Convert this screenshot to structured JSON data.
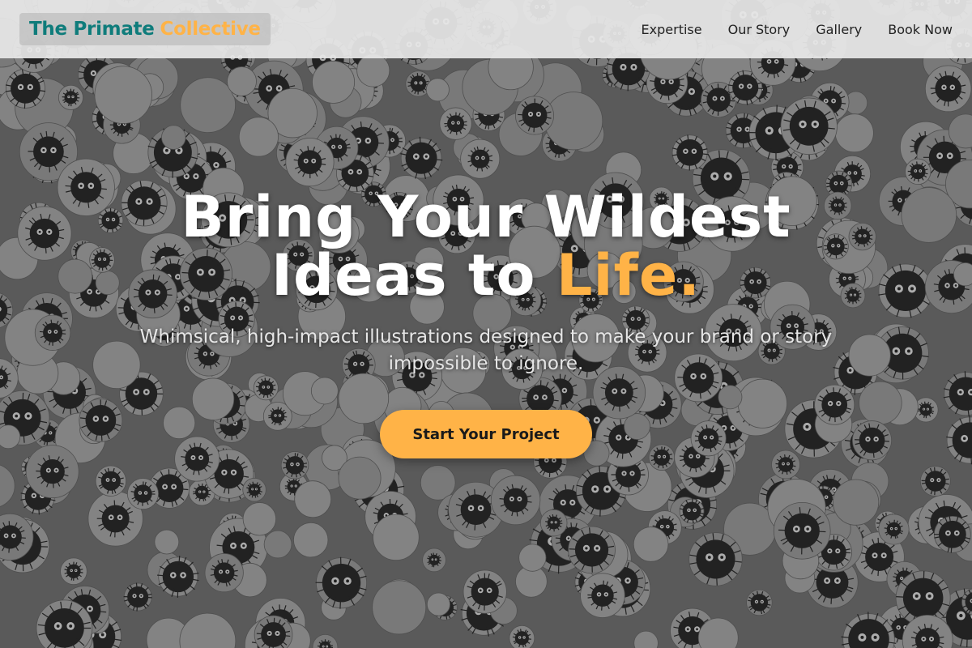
{
  "header": {
    "logo_part1": "The Primate",
    "logo_part2": "Collective",
    "nav": [
      "Expertise",
      "Our Story",
      "Gallery",
      "Book Now"
    ]
  },
  "hero": {
    "title_line1": "Bring Your Wildest",
    "title_line2_pre": "Ideas to ",
    "title_line2_accent": "Life.",
    "subtitle": "Whimsical, high-impact illustrations designed to make your brand or story impossible to ignore.",
    "cta_label": "Start Your Project"
  },
  "colors": {
    "accent": "#ffb347",
    "brand_teal": "#0f7c7b"
  }
}
